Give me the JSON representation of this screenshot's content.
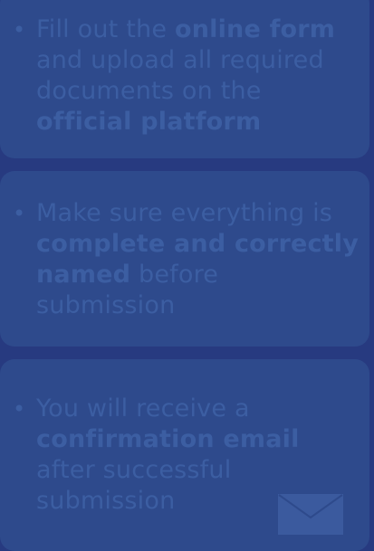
{
  "cards": [
    {
      "parts": [
        {
          "text": "Fill out the ",
          "bold": false
        },
        {
          "text": "online form",
          "bold": true
        },
        {
          "text": " and upload all required documents on the ",
          "bold": false
        },
        {
          "text": "official platform",
          "bold": true
        }
      ]
    },
    {
      "parts": [
        {
          "text": "Make sure everything is ",
          "bold": false
        },
        {
          "text": "complete and correctly named",
          "bold": true
        },
        {
          "text": " before submission",
          "bold": false
        }
      ]
    },
    {
      "parts": [
        {
          "text": "You will receive a ",
          "bold": false
        },
        {
          "text": "confirmation email",
          "bold": true
        },
        {
          "text": " after successful submission",
          "bold": false
        }
      ]
    }
  ],
  "bullet_glyph": "•",
  "icons": {
    "envelope": "envelope-icon"
  },
  "colors": {
    "background": "#273a80",
    "card": "#2e4a8c",
    "text": "#3c5ea2",
    "envelope": "#3b5a9e"
  }
}
